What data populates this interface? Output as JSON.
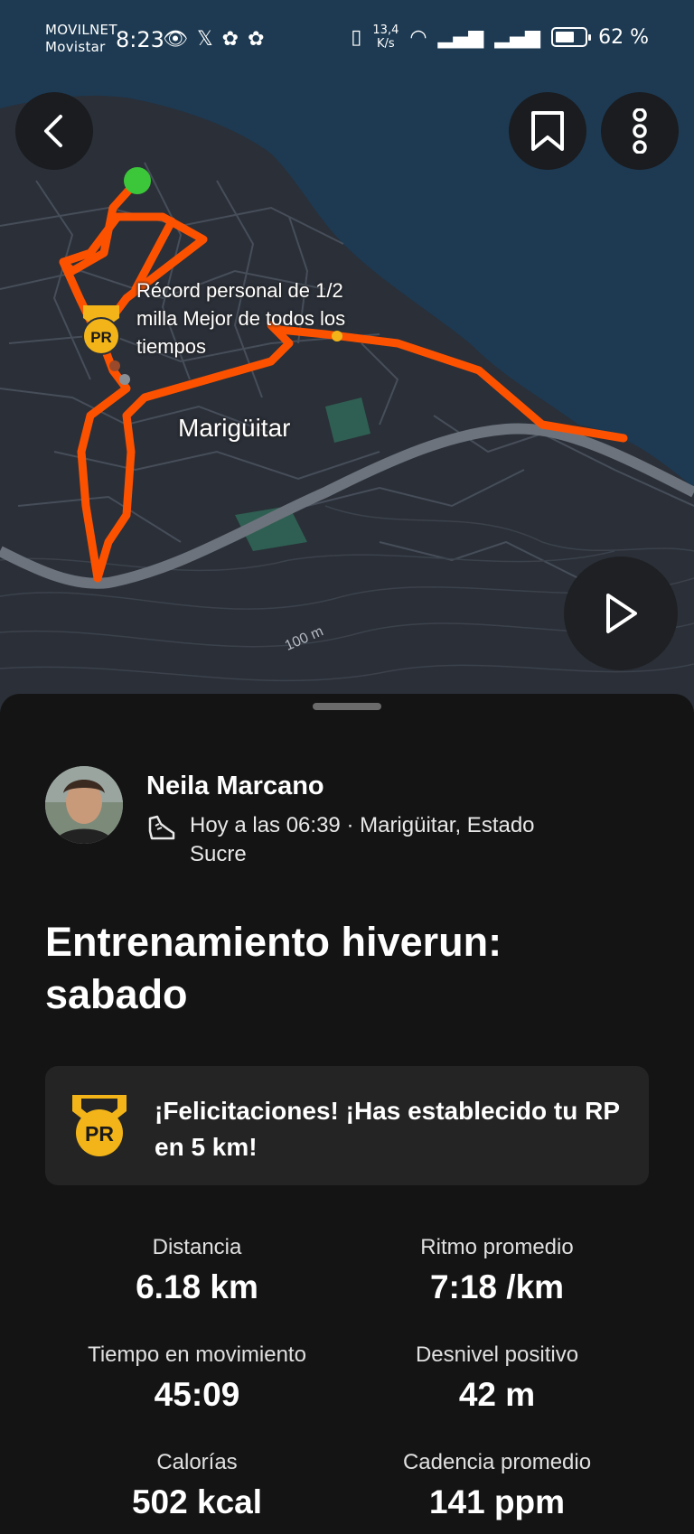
{
  "status_bar": {
    "carrier_1": "MOVILNET",
    "carrier_2": "Movistar",
    "time": "8:23",
    "net_speed_value": "13,4",
    "net_speed_unit": "K/s",
    "battery": "62 %"
  },
  "map": {
    "pr_annotation": "Récord personal de 1/2 milla Mejor de todos los tiempos",
    "town_label": "Marigüitar",
    "contour_label": "100 m",
    "route_color": "#fc5200",
    "start_color": "#3cc63a"
  },
  "activity": {
    "athlete_name": "Neila Marcano",
    "meta": "Hoy a las 06:39 · Marigüitar, Estado Sucre",
    "title": "Entrenamiento hiverun: sabado",
    "pr_message": "¡Felicitaciones! ¡Has establecido tu RP en 5 km!",
    "pr_badge": "PR"
  },
  "stats": [
    {
      "label": "Distancia",
      "value": "6.18 km"
    },
    {
      "label": "Ritmo promedio",
      "value": "7:18 /km"
    },
    {
      "label": "Tiempo en movimiento",
      "value": "45:09"
    },
    {
      "label": "Desnivel positivo",
      "value": "42 m"
    },
    {
      "label": "Calorías",
      "value": "502 kcal"
    },
    {
      "label": "Cadencia promedio",
      "value": "141 ppm"
    }
  ],
  "colors": {
    "accent": "#fc5200",
    "medal": "#f2b418",
    "sheet_bg": "#141414",
    "card_bg": "#242424"
  }
}
